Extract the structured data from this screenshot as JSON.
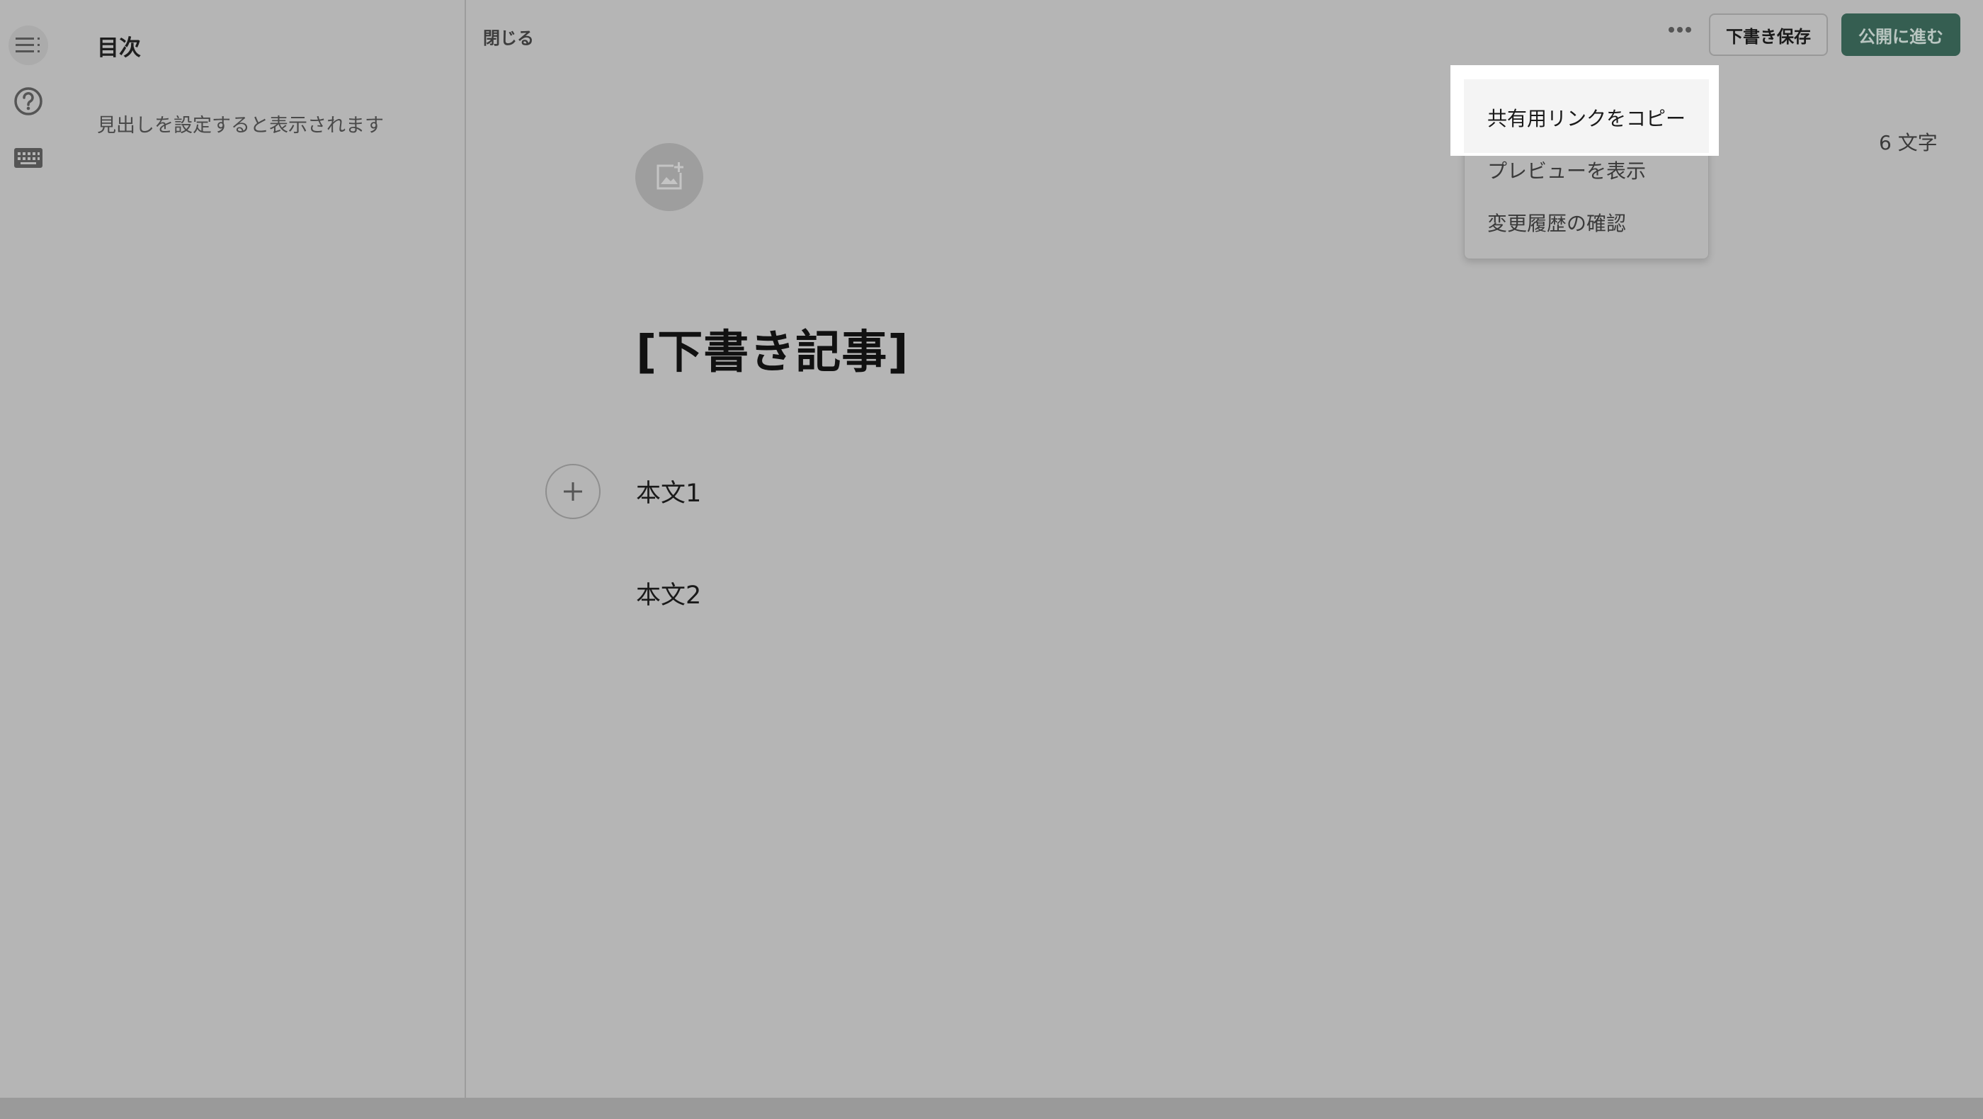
{
  "sidebar": {
    "toc_title": "目次",
    "toc_empty_message": "見出しを設定すると表示されます",
    "rail_icons": [
      "toc-list-icon",
      "help-icon",
      "keyboard-icon"
    ]
  },
  "header": {
    "close_label": "閉じる",
    "more_icon": "more-horizontal-icon",
    "save_draft_label": "下書き保存",
    "publish_label": "公開に進む"
  },
  "editor": {
    "char_count": "6 文字",
    "title": "[下書き記事]",
    "paragraphs": [
      "本文1",
      "本文2"
    ],
    "image_icon": "add-image-icon",
    "add_icon": "plus-icon"
  },
  "menu": {
    "items": [
      "共有用リンクをコピー",
      "プレビューを表示",
      "変更履歴の確認"
    ]
  },
  "colors": {
    "publish_button": "#355e51",
    "overlay": "#b5b5b5"
  }
}
